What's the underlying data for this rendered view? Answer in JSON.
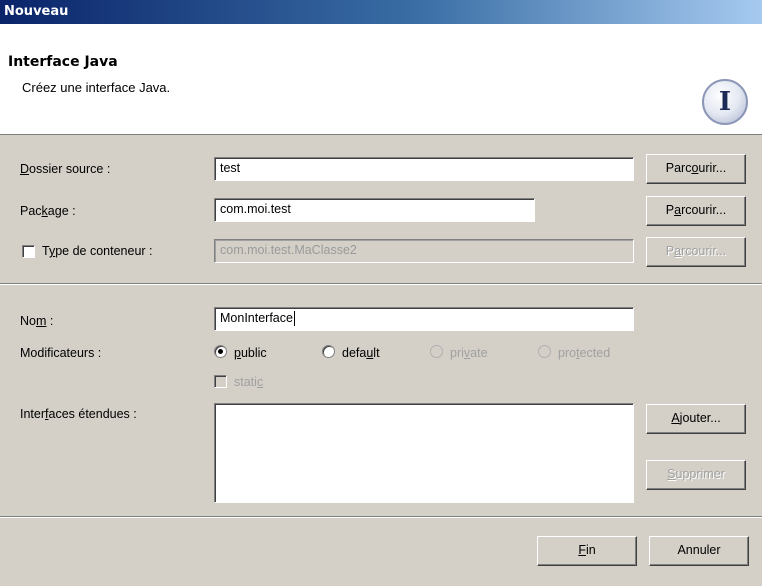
{
  "window": {
    "title": "Nouveau"
  },
  "header": {
    "title": "Interface Java",
    "description": "Créez une interface Java.",
    "badge_letter": "I",
    "badge_icon": "java-interface-icon"
  },
  "source_folder": {
    "label_pre": "",
    "label_mn": "D",
    "label_post": "ossier source :",
    "value": "test",
    "browse_pre": "Parc",
    "browse_mn": "o",
    "browse_post": "urir..."
  },
  "package": {
    "label_pre": "Pac",
    "label_mn": "k",
    "label_post": "age :",
    "value": "com.moi.test",
    "browse_pre": "P",
    "browse_mn": "a",
    "browse_post": "rcourir..."
  },
  "enclosing_type": {
    "checked": false,
    "label_pre": "T",
    "label_mn": "y",
    "label_post": "pe de conteneur :",
    "value": "com.moi.test.MaClasse2",
    "browse_pre": "P",
    "browse_mn": "a",
    "browse_post": "rcourir..."
  },
  "name": {
    "label_pre": "No",
    "label_mn": "m",
    "label_post": " :",
    "value": "MonInterface"
  },
  "modifiers": {
    "label": "Modificateurs :",
    "selected": "public",
    "public": {
      "pre": "",
      "mn": "p",
      "post": "ublic"
    },
    "default": {
      "pre": "defa",
      "mn": "u",
      "post": "lt"
    },
    "private": {
      "pre": "pri",
      "mn": "v",
      "post": "ate"
    },
    "protected": {
      "pre": "pro",
      "mn": "t",
      "post": "ected"
    },
    "static": {
      "pre": "stati",
      "mn": "c",
      "post": "",
      "checked": false
    }
  },
  "extended_interfaces": {
    "label_pre": "Inter",
    "label_mn": "f",
    "label_post": "aces étendues :",
    "items": [],
    "add_pre": "",
    "add_mn": "A",
    "add_post": "jouter...",
    "remove_pre": "",
    "remove_mn": "S",
    "remove_post": "upprimer"
  },
  "footer": {
    "finish_pre": "",
    "finish_mn": "F",
    "finish_post": "in",
    "cancel": "Annuler"
  }
}
